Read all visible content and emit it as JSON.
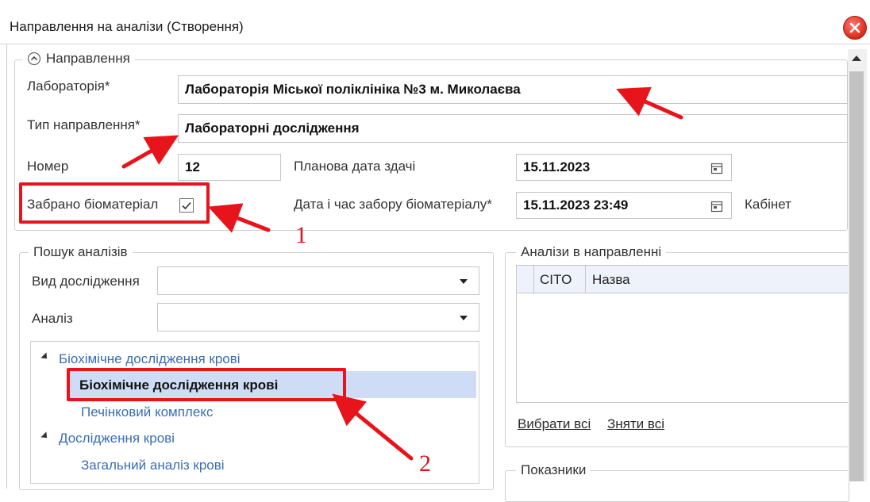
{
  "window": {
    "title": "Направлення на аналізи (Створення)"
  },
  "direction_group": {
    "legend": "Направлення",
    "laboratory": {
      "label": "Лабораторія*",
      "value": "Лабораторія Міської поліклініка №3 м. Миколаєва"
    },
    "direction_type": {
      "label": "Тип направлення*",
      "value": "Лабораторні дослідження"
    },
    "number": {
      "label": "Номер",
      "value": "12"
    },
    "planned_date": {
      "label": "Планова дата здачі",
      "value": "15.11.2023"
    },
    "collected": {
      "label": "Забрано біоматеріал",
      "checked": true
    },
    "collection_datetime": {
      "label": "Дата і час забору біоматеріалу*",
      "value": "15.11.2023 23:49"
    },
    "cabinet": {
      "label": "Кабінет"
    }
  },
  "search_group": {
    "legend": "Пошук аналізів",
    "research_type": {
      "label": "Вид дослідження",
      "value": ""
    },
    "analysis": {
      "label": "Аналіз",
      "value": ""
    },
    "tree": [
      {
        "label": "Біохімічне дослідження крові",
        "level": 0,
        "expanded": true
      },
      {
        "label": "Біохімічне дослідження крові",
        "level": 1,
        "selected": true
      },
      {
        "label": "Печінковий  комплекс",
        "level": 1
      },
      {
        "label": "Дослідження крові",
        "level": 0,
        "expanded": true
      },
      {
        "label": "Загальний аналіз крові",
        "level": 1
      }
    ]
  },
  "in_direction_group": {
    "legend": "Аналізи в направленні",
    "columns": [
      "CITO",
      "Назва"
    ],
    "select_all": "Вибрати всі",
    "deselect_all": "Зняти всі"
  },
  "indicators_group": {
    "legend": "Показники"
  },
  "annotations": {
    "marker1": "1",
    "marker2": "2"
  },
  "colors": {
    "accent_red": "#e8141c",
    "link_blue": "#3a6db3",
    "selection": "#cfdcf5"
  }
}
